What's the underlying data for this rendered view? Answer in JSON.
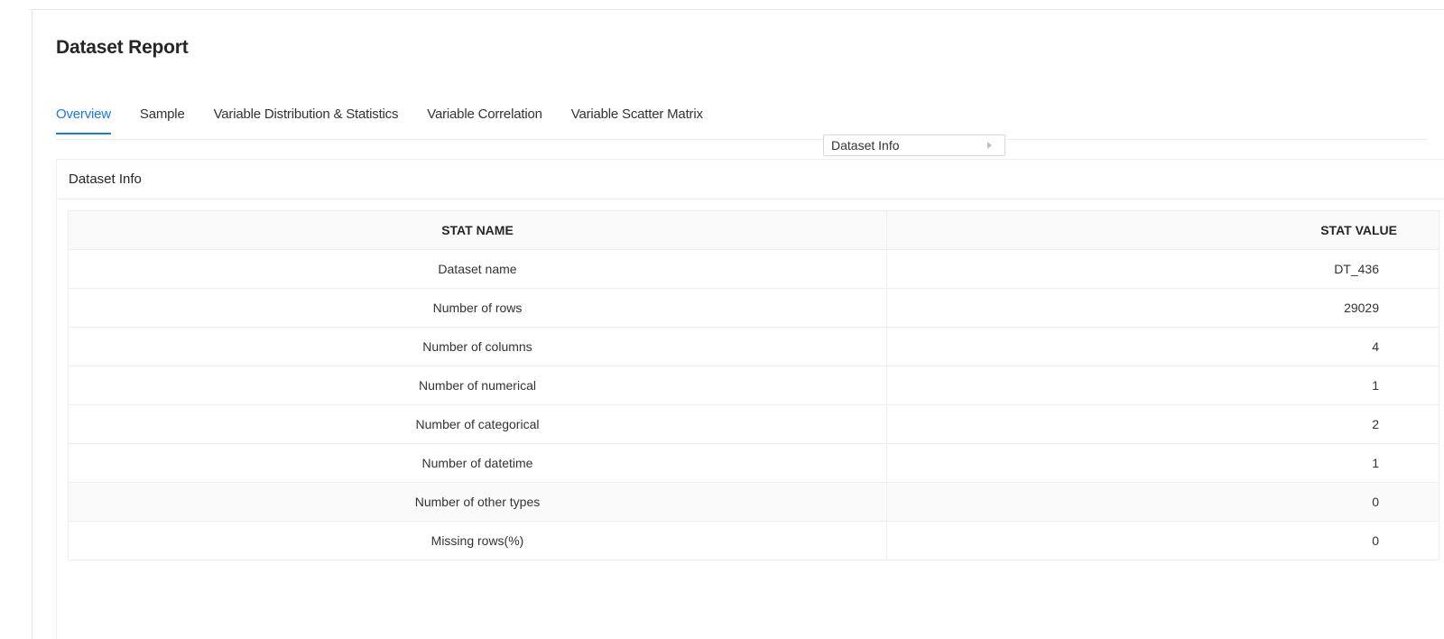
{
  "page": {
    "title": "Dataset Report"
  },
  "tabs": [
    {
      "label": "Overview",
      "active": true
    },
    {
      "label": "Sample",
      "active": false
    },
    {
      "label": "Variable Distribution & Statistics",
      "active": false
    },
    {
      "label": "Variable Correlation",
      "active": false
    },
    {
      "label": "Variable Scatter Matrix",
      "active": false
    }
  ],
  "section_select": {
    "value": "Dataset Info"
  },
  "card": {
    "title": "Dataset Info",
    "table": {
      "headers": [
        "STAT NAME",
        "STAT VALUE"
      ],
      "rows": [
        {
          "name": "Dataset name",
          "value": "DT_436"
        },
        {
          "name": "Number of rows",
          "value": "29029"
        },
        {
          "name": "Number of columns",
          "value": "4"
        },
        {
          "name": "Number of numerical",
          "value": "1"
        },
        {
          "name": "Number of categorical",
          "value": "2"
        },
        {
          "name": "Number of datetime",
          "value": "1"
        },
        {
          "name": "Number of other types",
          "value": "0"
        },
        {
          "name": "Missing rows(%)",
          "value": "0"
        }
      ]
    }
  },
  "colors": {
    "accent": "#1677ff",
    "border": "#eeeeee",
    "header_bg": "#fafafa"
  }
}
